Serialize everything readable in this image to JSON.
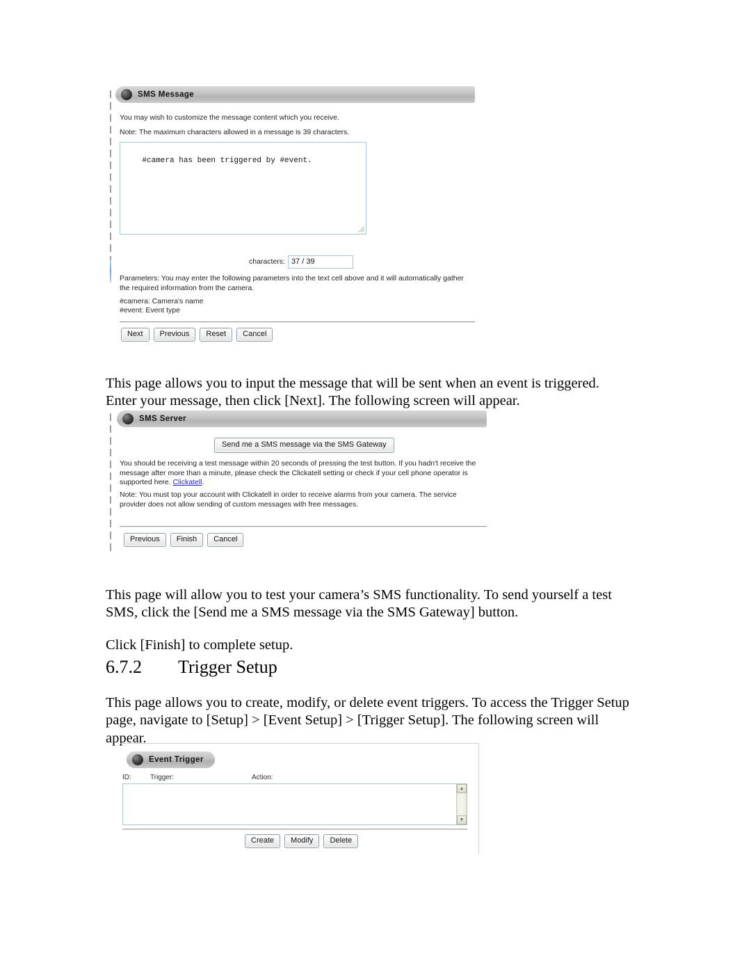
{
  "page": {
    "sections": {
      "sms_message_panel": {
        "title": "SMS Message",
        "icon": "sphere-icon",
        "line1": "You may wish to customize the message content which you receive.",
        "line2": "Note: The maximum characters allowed in a message is 39 characters.",
        "textarea_value": "#camera has been triggered by #event.",
        "counter_label": "characters:",
        "counter_value": "37 / 39",
        "params_intro": "Parameters: You may enter the following parameters into the text cell above and it will automatically gather the required information from the camera.",
        "param_lines": [
          "#camera: Camera's name",
          "#event: Event type"
        ],
        "buttons": [
          "Next",
          "Previous",
          "Reset",
          "Cancel"
        ]
      },
      "sms_server_panel": {
        "title": "SMS Server",
        "icon": "sphere-icon",
        "test_button": "Send me a SMS message via the SMS Gateway",
        "info_text_before_link": "You should be receiving a test message within 20 seconds of pressing the test button. If you hadn't receive the message after more than a minute, please check the Clickatell setting or check if your cell phone operator is supported here. ",
        "info_link": "Clickatell",
        "info_text_after_link": ".",
        "note_text": "Note: You must top your account with Clickatell in order to receive alarms from your camera. The service provider does not allow sending of custom messages with free messages.",
        "buttons": [
          "Previous",
          "Finish",
          "Cancel"
        ]
      },
      "event_trigger_panel": {
        "title": "Event Trigger",
        "icon": "sphere-icon",
        "columns": [
          "ID:",
          "Trigger:",
          "Action:"
        ],
        "rows": [],
        "buttons": [
          "Create",
          "Modify",
          "Delete"
        ],
        "scroll_up_icon": "chevron-up-icon",
        "scroll_down_icon": "chevron-down-icon"
      }
    },
    "body": {
      "para1": "This page allows you to input the message that will be sent when an event is triggered. Enter your message, then click [Next]. The following screen will appear.",
      "para2": "This page will allow you to test your camera’s SMS functionality. To send yourself a test SMS, click the [Send me a SMS message via the SMS Gateway] button.",
      "para3": "Click [Finish] to complete setup.",
      "heading_number": "6.7.2",
      "heading_title": "Trigger Setup",
      "para4": "This page allows you to create, modify, or delete event triggers. To access the Trigger Setup page, navigate to [Setup] > [Event Setup] > [Trigger Setup]. The following screen will appear."
    }
  },
  "colors": {
    "link": "#2222cc",
    "panel_header_start": "#d8d8d8",
    "panel_header_end": "#b4b4b4",
    "field_border": "#a9c6d6"
  }
}
